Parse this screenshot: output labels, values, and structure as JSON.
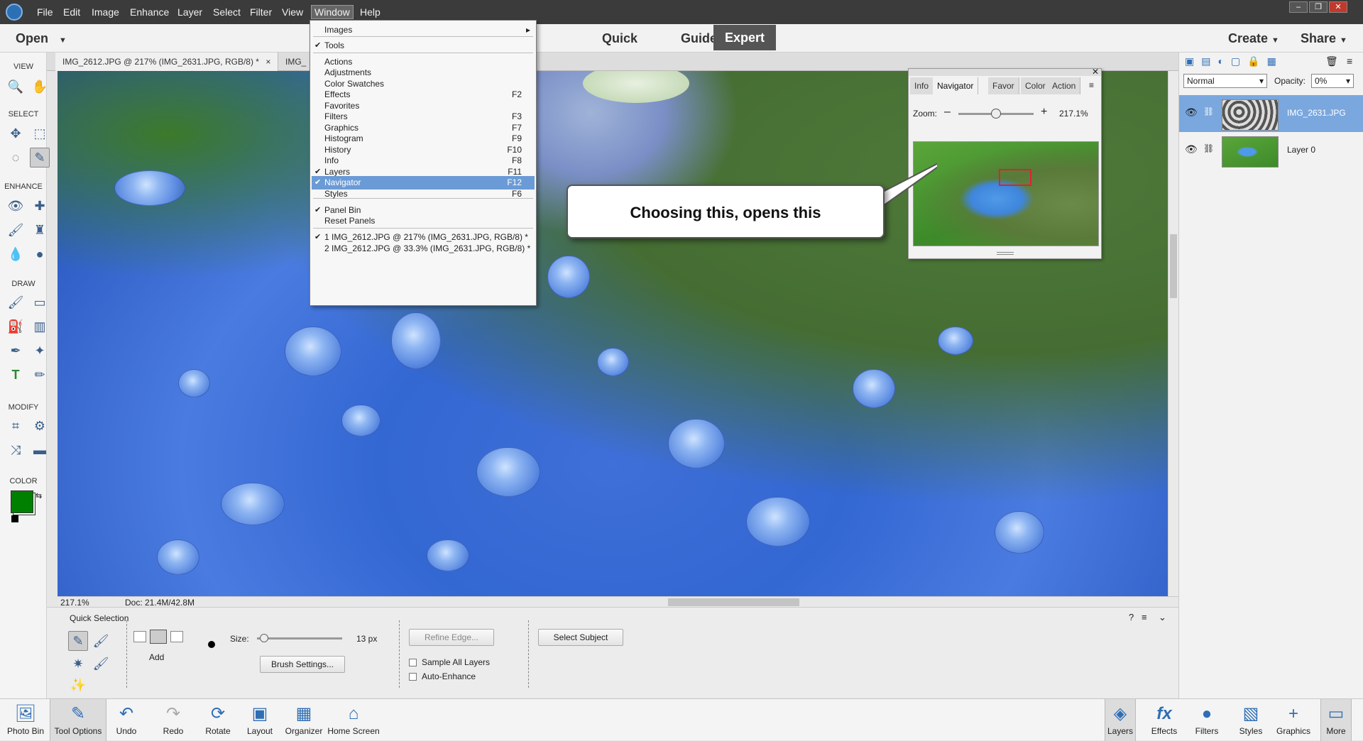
{
  "menubar": {
    "items": [
      "File",
      "Edit",
      "Image",
      "Enhance",
      "Layer",
      "Select",
      "Filter",
      "View",
      "Window",
      "Help"
    ],
    "active": "Window"
  },
  "modebar": {
    "open": "Open",
    "modes": [
      "Quick",
      "Guided",
      "Expert"
    ],
    "selected_mode": "Expert",
    "create": "Create",
    "share": "Share"
  },
  "doc_tabs": [
    {
      "label": "IMG_2612.JPG @ 217% (IMG_2631.JPG, RGB/8) *",
      "close": "×"
    },
    {
      "label": "IMG_"
    }
  ],
  "toolbar": {
    "sections": [
      "VIEW",
      "SELECT",
      "ENHANCE",
      "DRAW",
      "MODIFY",
      "COLOR"
    ],
    "foreground_color": "#008000",
    "background_color": "#ffffff"
  },
  "window_menu": {
    "items": [
      {
        "label": "Images",
        "shortcut": "",
        "checked": false,
        "submenu": true
      },
      {
        "label": "Tools",
        "shortcut": "",
        "checked": true
      },
      {
        "label": "Actions",
        "shortcut": "",
        "checked": false
      },
      {
        "label": "Adjustments",
        "shortcut": "",
        "checked": false
      },
      {
        "label": "Color Swatches",
        "shortcut": "",
        "checked": false
      },
      {
        "label": "Effects",
        "shortcut": "F2",
        "checked": false
      },
      {
        "label": "Favorites",
        "shortcut": "",
        "checked": false
      },
      {
        "label": "Filters",
        "shortcut": "F3",
        "checked": false
      },
      {
        "label": "Graphics",
        "shortcut": "F7",
        "checked": false
      },
      {
        "label": "Histogram",
        "shortcut": "F9",
        "checked": false
      },
      {
        "label": "History",
        "shortcut": "F10",
        "checked": false
      },
      {
        "label": "Info",
        "shortcut": "F8",
        "checked": false
      },
      {
        "label": "Layers",
        "shortcut": "F11",
        "checked": true
      },
      {
        "label": "Navigator",
        "shortcut": "F12",
        "checked": true,
        "highlighted": true
      },
      {
        "label": "Styles",
        "shortcut": "F6",
        "checked": false
      },
      {
        "label": "Panel Bin",
        "shortcut": "",
        "checked": true
      },
      {
        "label": "Reset Panels",
        "shortcut": "",
        "checked": false
      },
      {
        "label": "1 IMG_2612.JPG @ 217% (IMG_2631.JPG, RGB/8) *",
        "shortcut": "",
        "checked": true
      },
      {
        "label": "2 IMG_2612.JPG @ 33.3% (IMG_2631.JPG, RGB/8) *",
        "shortcut": "",
        "checked": false
      }
    ]
  },
  "callout": {
    "text": "Choosing this, opens this"
  },
  "navigator": {
    "tabs": [
      "Info",
      "Navigator",
      "Favor",
      "Color",
      "Action"
    ],
    "selected_tab": "Navigator",
    "zoom_label": "Zoom:",
    "zoom_value": "217.1%",
    "zoom_fraction": 0.5
  },
  "status": {
    "zoom": "217.1%",
    "doc": "Doc: 21.4M/42.8M"
  },
  "options": {
    "tool_name": "Quick Selection",
    "add_label": "Add",
    "size_label": "Size:",
    "size_value": "13 px",
    "brush_settings": "Brush Settings...",
    "refine_edge": "Refine Edge...",
    "sample_all_layers": "Sample All Layers",
    "auto_enhance": "Auto-Enhance",
    "select_subject": "Select Subject"
  },
  "layers": {
    "blend_mode": "Normal",
    "opacity_label": "Opacity:",
    "opacity_value": "0%",
    "items": [
      {
        "name": "IMG_2631.JPG",
        "selected": true
      },
      {
        "name": "Layer 0",
        "selected": false
      }
    ]
  },
  "bottom_left": [
    "Photo Bin",
    "Tool Options",
    "Undo",
    "Redo",
    "Rotate",
    "Layout",
    "Organizer",
    "Home Screen"
  ],
  "bottom_right": [
    "Layers",
    "Effects",
    "Filters",
    "Styles",
    "Graphics",
    "More"
  ]
}
